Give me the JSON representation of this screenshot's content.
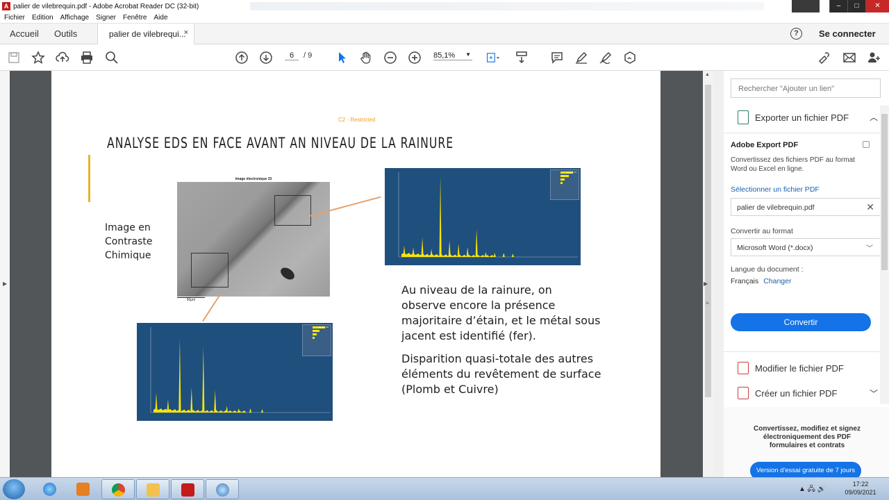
{
  "window": {
    "title": "palier de vilebrequin.pdf - Adobe Acrobat Reader DC (32-bit)",
    "controls": [
      "–",
      "□",
      "✕"
    ]
  },
  "menubar": [
    "Fichier",
    "Edition",
    "Affichage",
    "Signer",
    "Fenêtre",
    "Aide"
  ],
  "tabs": {
    "home": "Accueil",
    "tools": "Outils",
    "doc": "palier de vilebrequi...",
    "close": "×",
    "signin": "Se connecter",
    "help": "?"
  },
  "toolbar": {
    "page_current": "6",
    "page_total": "/ 9",
    "zoom": "85,1%"
  },
  "slide": {
    "restricted": "C2 - Restricted",
    "title": "ANALYSE EDS EN FACE AVANT AN NIVEAU DE LA RAINURE",
    "side_label": [
      "Image en",
      "Contraste",
      "Chimique"
    ],
    "sem_title": "Image électronique 33",
    "sem_scale": "50µm",
    "paragraph1": [
      "Au niveau de la rainure, on",
      "observe encore la présence",
      "majoritaire d’étain, et le métal sous",
      "jacent est identifié (fer)."
    ],
    "paragraph2": [
      "Disparition quasi-totale des autres",
      "éléments du revêtement de surface",
      "(Plomb et Cuivre)"
    ]
  },
  "spectra": {
    "top": {
      "legend": "Spectre 47",
      "peaks": [
        0.14,
        0.12,
        0.24,
        0.1,
        0.98,
        0.2,
        0.16,
        0.12,
        0.34,
        0.06,
        0.05,
        0.05,
        0.04
      ]
    },
    "bottom": {
      "legend": "Spectre 48",
      "peaks": [
        0.24,
        0.16,
        0.9,
        0.3,
        0.8,
        0.27,
        0.08,
        0.05,
        0.05,
        0.04
      ]
    }
  },
  "rightpanel": {
    "search_placeholder": "Rechercher \"Ajouter un lien\"",
    "export_header": "Exporter un fichier PDF",
    "export_title": "Adobe Export PDF",
    "export_desc": "Convertissez des fichiers PDF au format Word ou Excel en ligne.",
    "select_file": "Sélectionner un fichier PDF",
    "file_name": "palier de vilebrequin.pdf",
    "convert_to_label": "Convertir au format",
    "format": "Microsoft Word (*.docx)",
    "lang_label": "Langue du document :",
    "lang_value": "Français",
    "lang_change": "Changer",
    "convert_button": "Convertir",
    "tool_edit": "Modifier le fichier PDF",
    "tool_create": "Créer un fichier PDF",
    "promo_text": "Convertissez, modifiez et signez électroniquement des PDF formulaires et contrats",
    "promo_button": "Version d'essai gratuite de 7 jours"
  },
  "taskbar": {
    "time": "17:22",
    "date": "09/09/2021"
  },
  "colors": {
    "accent_blue": "#1473e6",
    "gold": "#e5b52c",
    "spectrum_bg": "#1f4f7d",
    "spectrum_peak": "#ffe600"
  }
}
